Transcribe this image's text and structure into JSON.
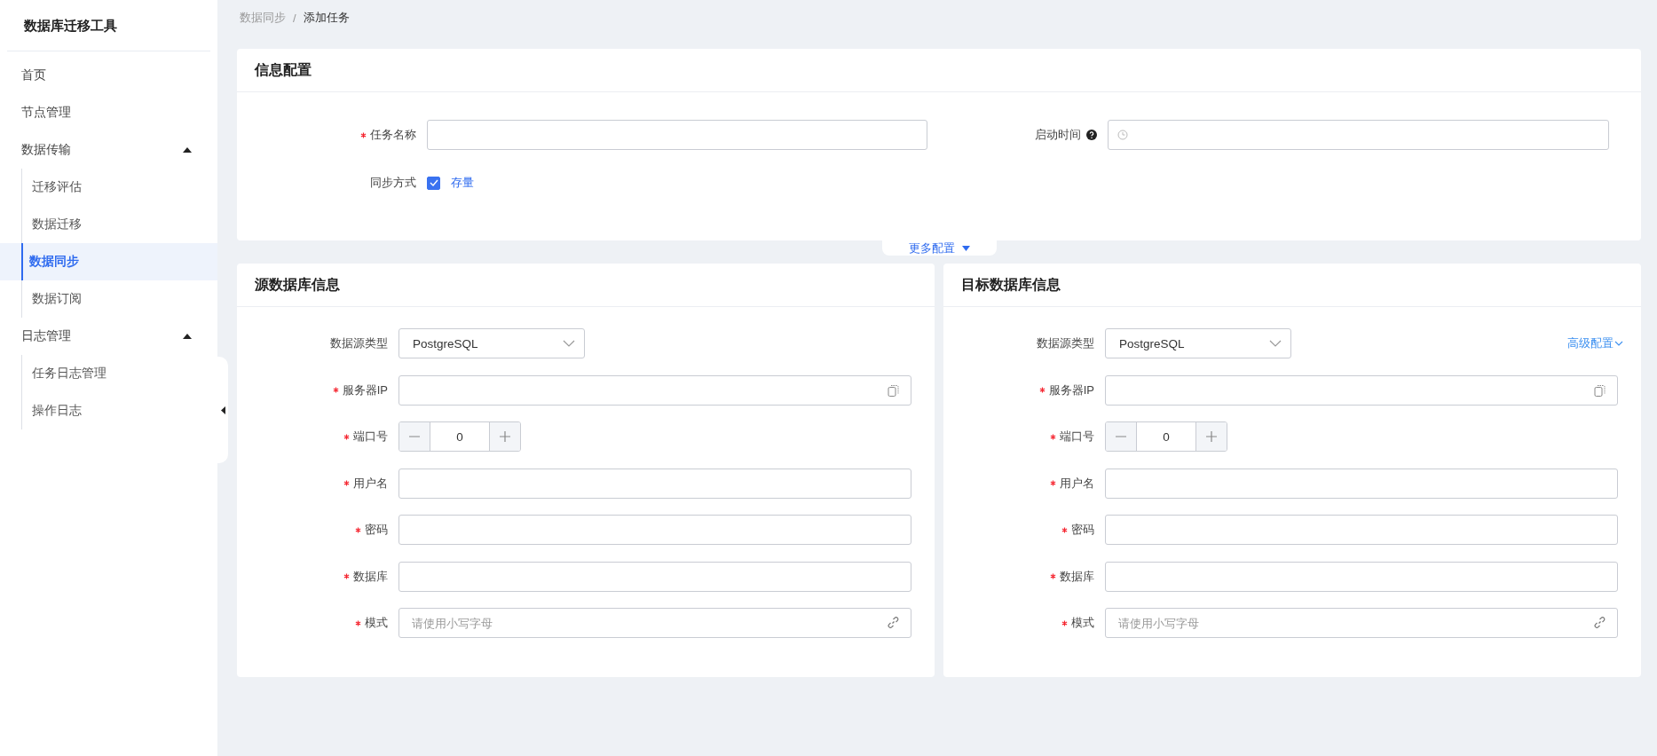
{
  "sidebar": {
    "title": "数据库迁移工具",
    "items": [
      {
        "label": "首页",
        "selected": false
      },
      {
        "label": "节点管理",
        "selected": false
      },
      {
        "label": "数据传输",
        "selected": false,
        "expanded": true,
        "children": [
          {
            "label": "迁移评估",
            "selected": false
          },
          {
            "label": "数据迁移",
            "selected": false
          },
          {
            "label": "数据同步",
            "selected": true
          },
          {
            "label": "数据订阅",
            "selected": false
          }
        ]
      },
      {
        "label": "日志管理",
        "selected": false,
        "expanded": true,
        "children": [
          {
            "label": "任务日志管理",
            "selected": false
          },
          {
            "label": "操作日志",
            "selected": false
          }
        ]
      }
    ]
  },
  "breadcrumb": [
    {
      "label": "数据同步"
    },
    {
      "label": "/"
    },
    {
      "label": "添加任务"
    }
  ],
  "info_config": {
    "title": "信息配置",
    "fields": [
      {
        "kind": "text",
        "label": "任务名称",
        "required": true
      },
      {
        "kind": "time",
        "label": "启动时间",
        "required": false
      },
      {
        "kind": "checkbox",
        "label": "同步方式",
        "required": false,
        "option": {
          "label": "存量",
          "checked": true
        }
      }
    ],
    "more_link": {
      "label": "更多配置"
    }
  },
  "panels": [
    {
      "title": "源数据库信息",
      "fields": [
        {
          "kind": "select",
          "label": "数据源类型",
          "required": false,
          "value": "PostgreSQL"
        },
        {
          "kind": "copyable",
          "label": "服务器IP",
          "required": true
        },
        {
          "kind": "number",
          "label": "端口号",
          "required": true,
          "value": "0"
        },
        {
          "kind": "text",
          "label": "用户名",
          "required": true
        },
        {
          "kind": "text",
          "label": "密码",
          "required": true
        },
        {
          "kind": "text",
          "label": "数据库",
          "required": true
        },
        {
          "kind": "linkable",
          "label": "模式",
          "required": true,
          "placeholder": "请使用小写字母"
        }
      ]
    },
    {
      "title": "目标数据库信息",
      "advanced_link": {
        "label": "高级配置"
      },
      "fields": [
        {
          "kind": "select",
          "label": "数据源类型",
          "required": false,
          "value": "PostgreSQL"
        },
        {
          "kind": "copyable",
          "label": "服务器IP",
          "required": true
        },
        {
          "kind": "number",
          "label": "端口号",
          "required": true,
          "value": "0"
        },
        {
          "kind": "text",
          "label": "用户名",
          "required": true
        },
        {
          "kind": "text",
          "label": "密码",
          "required": true
        },
        {
          "kind": "text",
          "label": "数据库",
          "required": true
        },
        {
          "kind": "linkable",
          "label": "模式",
          "required": true,
          "placeholder": "请使用小写字母"
        }
      ]
    }
  ]
}
